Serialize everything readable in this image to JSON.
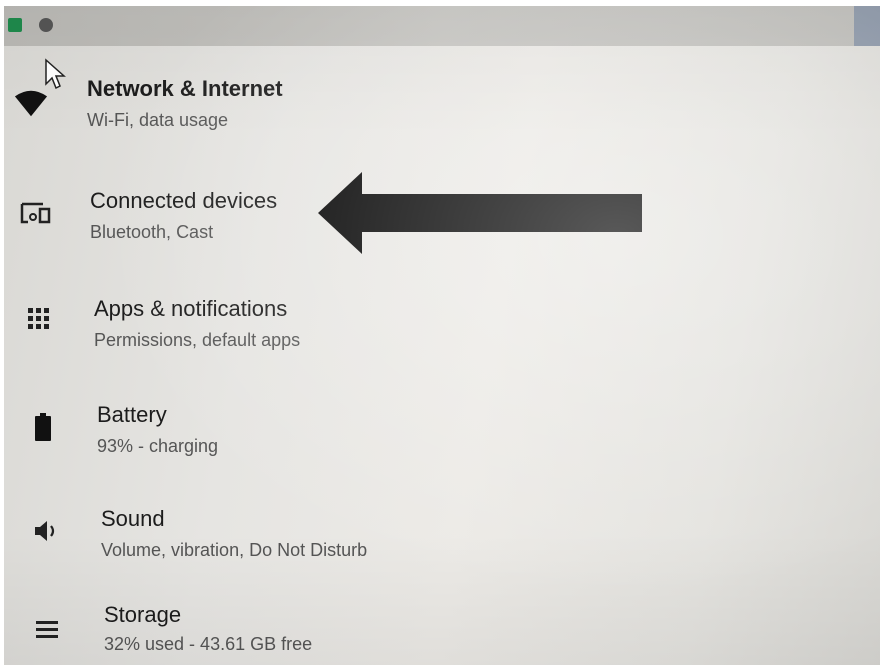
{
  "settings": {
    "items": [
      {
        "id": "network",
        "icon": "wifi-icon",
        "title": "Network & Internet",
        "subtitle": "Wi-Fi, data usage"
      },
      {
        "id": "connected-devices",
        "icon": "devices-icon",
        "title": "Connected devices",
        "subtitle": "Bluetooth, Cast"
      },
      {
        "id": "apps",
        "icon": "apps-grid-icon",
        "title": "Apps & notifications",
        "subtitle": "Permissions, default apps"
      },
      {
        "id": "battery",
        "icon": "battery-icon",
        "title": "Battery",
        "subtitle": "93% - charging"
      },
      {
        "id": "sound",
        "icon": "volume-icon",
        "title": "Sound",
        "subtitle": "Volume, vibration, Do Not Disturb"
      },
      {
        "id": "storage",
        "icon": "storage-icon",
        "title": "Storage",
        "subtitle": "32% used - 43.61 GB free"
      }
    ]
  },
  "colors": {
    "background": "#e6e5e2",
    "status_bar": "#c2c1bd",
    "text_primary": "#1c1c1c",
    "text_secondary": "#555555",
    "arrow": "#000000",
    "app_badge": "#1f8a4c"
  },
  "annotation": {
    "arrow_target": "connected-devices"
  }
}
